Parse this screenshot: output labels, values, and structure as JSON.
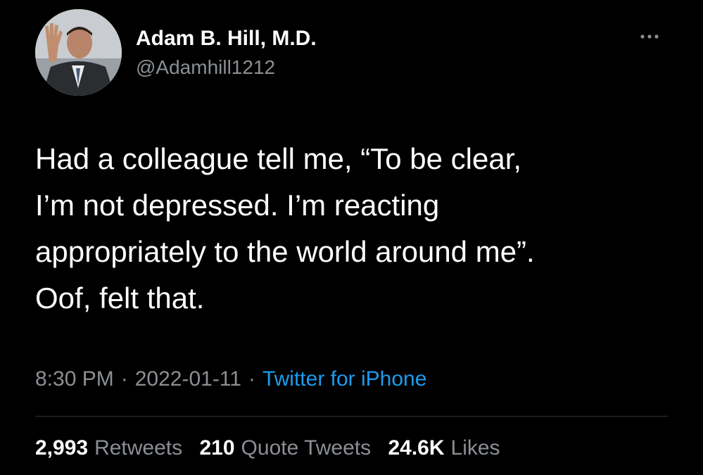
{
  "tweet": {
    "author": {
      "display_name": "Adam B. Hill, M.D.",
      "handle": "@Adamhill1212"
    },
    "text_lines": [
      "Had a colleague tell me, “To be clear,",
      "I’m not depressed. I’m reacting",
      "appropriately to the world around me”.",
      "Oof, felt that."
    ],
    "time": "8:30 PM",
    "date": "2022-01-11",
    "separator": "·",
    "source": "Twitter for iPhone",
    "stats": {
      "retweets_count": "2,993",
      "retweets_label": "Retweets",
      "quotes_count": "210",
      "quotes_label": "Quote Tweets",
      "likes_count": "24.6K",
      "likes_label": "Likes"
    }
  },
  "colors": {
    "background": "#000000",
    "primary_text": "#ffffff",
    "secondary_text": "#8b8f94",
    "link": "#1d9bf0",
    "divider": "#2f3336"
  },
  "icons": {
    "more": "more-horizontal-icon",
    "avatar": "profile-photo"
  }
}
